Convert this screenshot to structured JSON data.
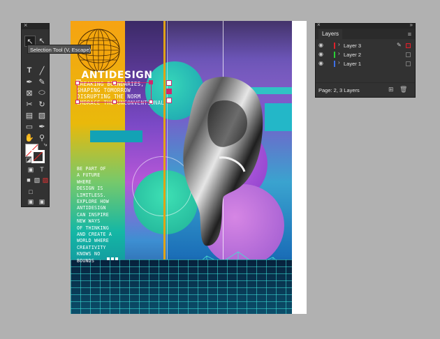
{
  "tooltip": {
    "text": "Selection Tool (V, Escape)"
  },
  "artwork": {
    "title": "_ANTIDESIGN",
    "subtitle_lines": [
      "BREAKING BOUNDARIES,",
      "SHAPING TOMORROW",
      "DISRUPTING THE NORM",
      "EMBRACE THE UNCONVENTIONAL"
    ],
    "body_lines": [
      "BE PART OF",
      "A FUTURE",
      "WHERE",
      "DESIGN IS",
      "LIMITLESS.",
      "EXPLORE HOW",
      "ANTIDESIGN",
      "CAN INSPIRE",
      "NEW WAYS",
      "OF THINKING",
      "AND CREATE A",
      "WORLD WHERE",
      "CREATIVITY",
      "KNOWS NO",
      "BOUNDS"
    ]
  },
  "layers_panel": {
    "tab_label": "Layers",
    "layers": [
      {
        "name": "Layer 3",
        "color": "#e0202a",
        "selected": true
      },
      {
        "name": "Layer 2",
        "color": "#29d236"
      },
      {
        "name": "Layer 1",
        "color": "#3d6fe6"
      }
    ],
    "footer_text": "Page: 2, 3 Layers"
  },
  "colors": {
    "selection": "#d2286e",
    "panel_bg": "#323232",
    "pasteboard": "#b1b1b1"
  }
}
